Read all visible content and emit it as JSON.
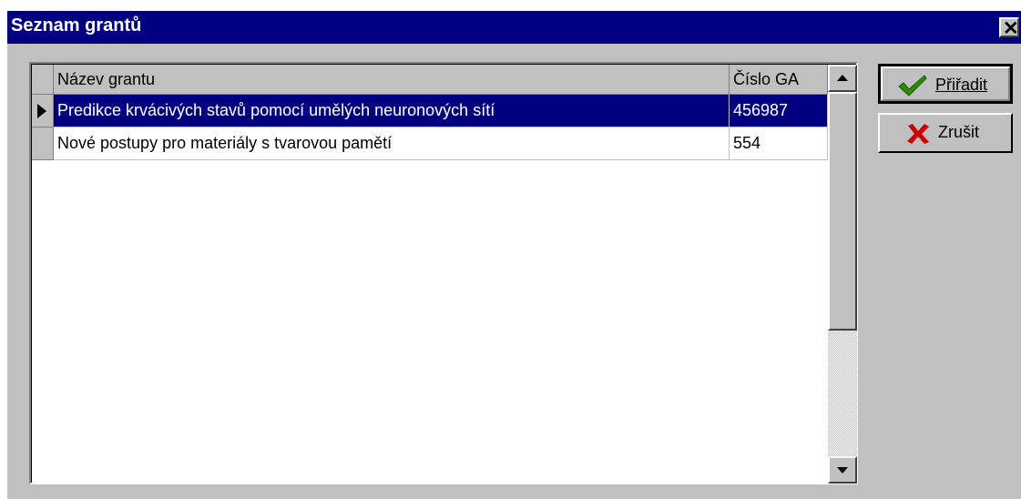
{
  "window": {
    "title": "Seznam grantů",
    "close_glyph": "✕"
  },
  "grid": {
    "columns": [
      "Název grantu",
      "Číslo GA"
    ],
    "rows": [
      {
        "name": "Predikce krvácivých stavů pomocí umělých neuronových sítí",
        "number": "456987",
        "selected": true
      },
      {
        "name": "Nové postupy pro materiály s tvarovou pamětí",
        "number": "554",
        "selected": false
      }
    ]
  },
  "buttons": {
    "assign": {
      "label": "Přiřadit",
      "icon": "checkmark-icon",
      "color": "#2e8b00"
    },
    "cancel": {
      "label": "Zrušit",
      "icon": "x-icon",
      "color": "#cc0000"
    }
  },
  "colors": {
    "titlebar": "#000080",
    "face": "#c0c0c0",
    "selection": "#000080"
  }
}
